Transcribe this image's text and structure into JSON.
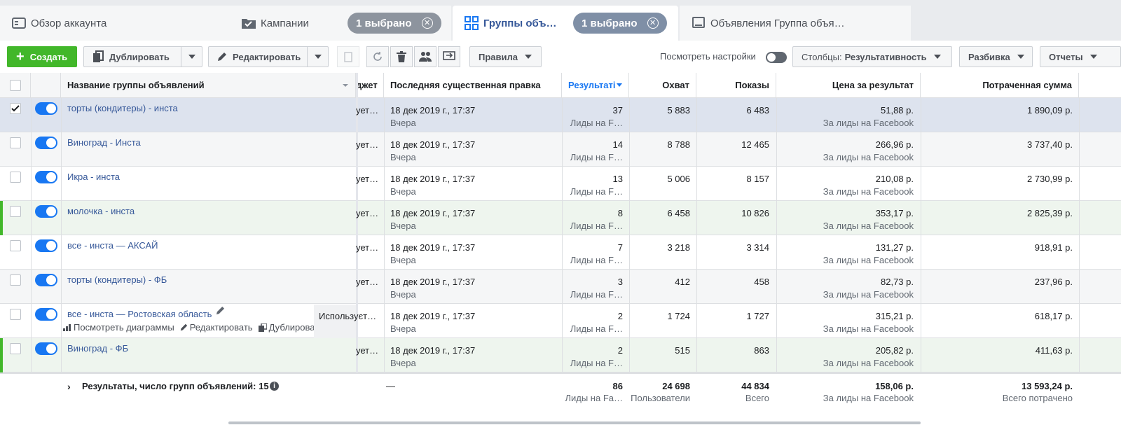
{
  "tabs": {
    "overview": "Обзор аккаунта",
    "campaigns": "Кампании",
    "campaigns_pill": "1 выбрано",
    "adsets": "Группы объ…",
    "adsets_pill": "1 выбрано",
    "ads": "Объявления Группа объя…"
  },
  "toolbar": {
    "create": "Создать",
    "duplicate": "Дублировать",
    "edit": "Редактировать",
    "rules": "Правила",
    "view_settings": "Посмотреть настройки",
    "columns_prefix": "Столбцы:",
    "columns_value": "Результативность",
    "breakdown": "Разбивка",
    "reports": "Отчеты"
  },
  "headers": {
    "name": "Название группы объявлений",
    "budget": "джет",
    "last_edit": "Последняя существенная правка",
    "results": "Результаті",
    "reach": "Охват",
    "impressions": "Показы",
    "cost_per_result": "Цена за результат",
    "spent": "Потраченная сумма"
  },
  "rows": [
    {
      "name": "торты (кондитеры) - инста",
      "budget": "ует…",
      "date": "18 дек 2019 г., 17:37",
      "date_sub": "Вчера",
      "results": "37",
      "results_sub": "Лиды на F…",
      "reach": "5 883",
      "impressions": "6 483",
      "cpr": "51,88 р.",
      "cpr_sub": "За лиды на Facebook",
      "spent": "1 890,09 р."
    },
    {
      "name": "Виноград - Инста",
      "budget": "ует…",
      "date": "18 дек 2019 г., 17:37",
      "date_sub": "Вчера",
      "results": "14",
      "results_sub": "Лиды на F…",
      "reach": "8 788",
      "impressions": "12 465",
      "cpr": "266,96 р.",
      "cpr_sub": "За лиды на Facebook",
      "spent": "3 737,40 р."
    },
    {
      "name": "Икра - инста",
      "budget": "ует…",
      "date": "18 дек 2019 г., 17:37",
      "date_sub": "Вчера",
      "results": "13",
      "results_sub": "Лиды на F…",
      "reach": "5 006",
      "impressions": "8 157",
      "cpr": "210,08 р.",
      "cpr_sub": "За лиды на Facebook",
      "spent": "2 730,99 р."
    },
    {
      "name": "молочка - инста",
      "budget": "ует…",
      "date": "18 дек 2019 г., 17:37",
      "date_sub": "Вчера",
      "results": "8",
      "results_sub": "Лиды на F…",
      "reach": "6 458",
      "impressions": "10 826",
      "cpr": "353,17 р.",
      "cpr_sub": "За лиды на Facebook",
      "spent": "2 825,39 р."
    },
    {
      "name": "все - инста — АКСАЙ",
      "budget": "ует…",
      "date": "18 дек 2019 г., 17:37",
      "date_sub": "Вчера",
      "results": "7",
      "results_sub": "Лиды на F…",
      "reach": "3 218",
      "impressions": "3 314",
      "cpr": "131,27 р.",
      "cpr_sub": "За лиды на Facebook",
      "spent": "918,91 р."
    },
    {
      "name": "торты (кондитеры) - ФБ",
      "budget": "ует…",
      "date": "18 дек 2019 г., 17:37",
      "date_sub": "Вчера",
      "results": "3",
      "results_sub": "Лиды на F…",
      "reach": "412",
      "impressions": "458",
      "cpr": "82,73 р.",
      "cpr_sub": "За лиды на Facebook",
      "spent": "237,96 р."
    },
    {
      "name": "все - инста — Ростовская область",
      "budget": "Используєт…",
      "date": "18 дек 2019 г., 17:37",
      "date_sub": "Вчера",
      "results": "2",
      "results_sub": "Лиды на F…",
      "reach": "1 724",
      "impressions": "1 727",
      "cpr": "315,21 р.",
      "cpr_sub": "За лиды на Facebook",
      "spent": "618,17 р."
    },
    {
      "name": "Виноград - ФБ",
      "budget": "ует…",
      "date": "18 дек 2019 г., 17:37",
      "date_sub": "Вчера",
      "results": "2",
      "results_sub": "Лиды на F…",
      "reach": "515",
      "impressions": "863",
      "cpr": "205,82 р.",
      "cpr_sub": "За лиды на Facebook",
      "spent": "411,63 р."
    }
  ],
  "hover_actions": {
    "charts": "Посмотреть диаграммы",
    "edit": "Редактировать",
    "duplicate": "Дублировать"
  },
  "footer": {
    "label": "Результаты, число групп объявлений: 15",
    "last_edit": "—",
    "results": "86",
    "results_sub": "Лиды на Fa…",
    "reach": "24 698",
    "reach_sub": "Пользователи",
    "impressions": "44 834",
    "impressions_sub": "Всего",
    "cpr": "158,06 р.",
    "cpr_sub": "За лиды на Facebook",
    "spent": "13 593,24 р.",
    "spent_sub": "Всего потрачено"
  },
  "colors": {
    "accent": "#1877f2",
    "link": "#365899",
    "create_green": "#42b72a"
  }
}
